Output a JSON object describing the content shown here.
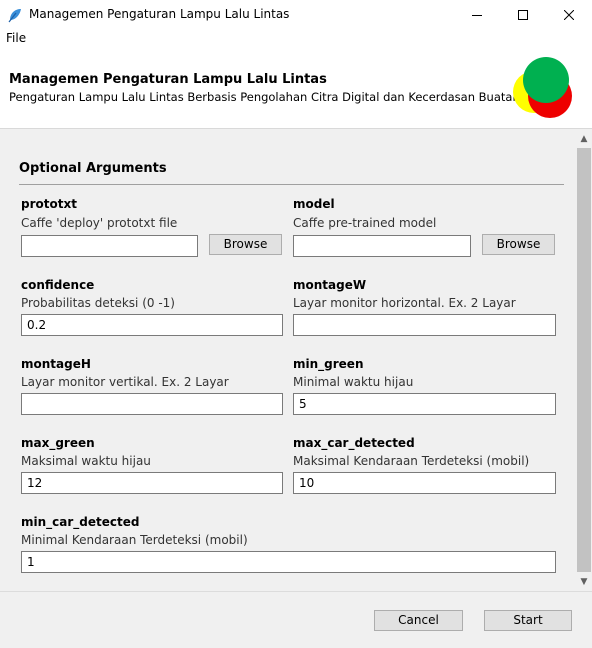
{
  "window": {
    "title": "Managemen Pengaturan Lampu Lalu Lintas",
    "minimize_glyph": "—",
    "maximize_glyph": "☐",
    "close_glyph": "✕"
  },
  "menu": {
    "file_label": "File"
  },
  "header": {
    "title": "Managemen Pengaturan Lampu Lalu Lintas",
    "subtitle": "Pengaturan Lampu Lalu Lintas Berbasis Pengolahan Citra Digital dan Kecerdasan Buatan"
  },
  "section": {
    "title": "Optional Arguments"
  },
  "fields": {
    "prototxt": {
      "label": "prototxt",
      "help": "Caffe 'deploy' prototxt file",
      "value": "",
      "button": "Browse"
    },
    "model": {
      "label": "model",
      "help": "Caffe pre-trained model",
      "value": "",
      "button": "Browse"
    },
    "confidence": {
      "label": "confidence",
      "help": "Probabilitas deteksi (0 -1)",
      "value": "0.2"
    },
    "montageW": {
      "label": "montageW",
      "help": "Layar monitor horizontal. Ex. 2 Layar",
      "value": ""
    },
    "montageH": {
      "label": "montageH",
      "help": "Layar monitor vertikal. Ex. 2 Layar",
      "value": ""
    },
    "min_green": {
      "label": "min_green",
      "help": "Minimal waktu hijau",
      "value": "5"
    },
    "max_green": {
      "label": "max_green",
      "help": "Maksimal waktu hijau",
      "value": "12"
    },
    "max_car_detected": {
      "label": "max_car_detected",
      "help": "Maksimal Kendaraan Terdeteksi (mobil)",
      "value": "10"
    },
    "min_car_detected": {
      "label": "min_car_detected",
      "help": "Minimal Kendaraan Terdeteksi (mobil)",
      "value": "1"
    }
  },
  "footer": {
    "cancel_label": "Cancel",
    "start_label": "Start"
  },
  "colors": {
    "logo_yellow": "#ffff00",
    "logo_red": "#ee0000",
    "logo_green": "#00b050",
    "scroll_thumb": "#c2c2c2"
  },
  "icons": {
    "app": "feather-app-icon",
    "logo": "traffic-light-logo"
  }
}
